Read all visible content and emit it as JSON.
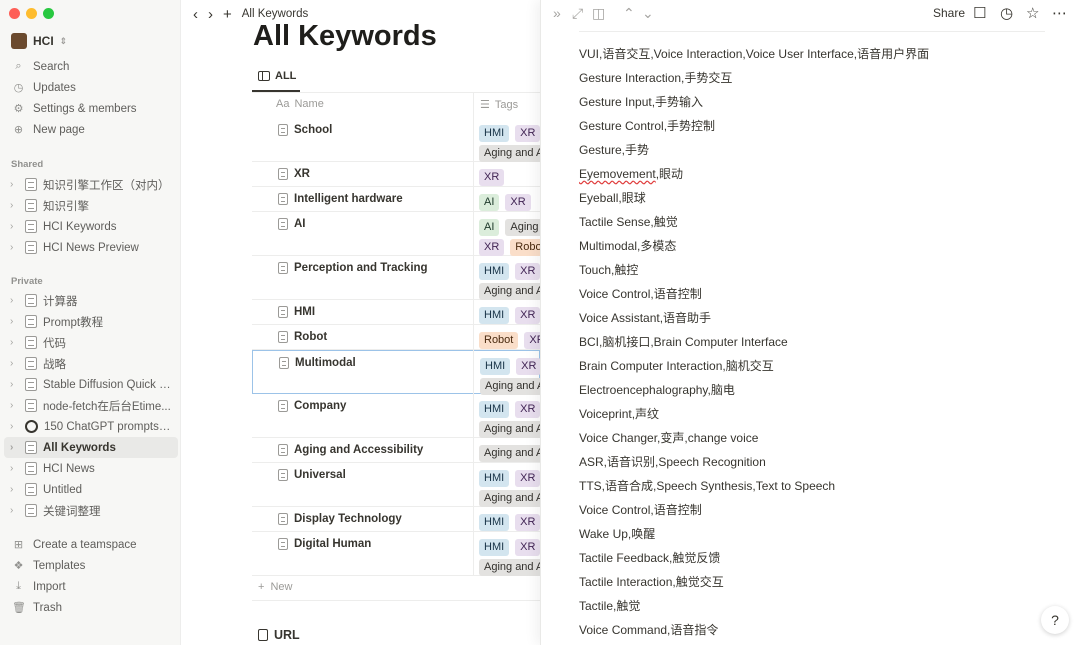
{
  "window": {
    "breadcrumb": "All Keywords"
  },
  "sidebar": {
    "workspace": "HCI",
    "nav": [
      {
        "label": "Search",
        "icon": "search-icon",
        "glyph": "⌕"
      },
      {
        "label": "Updates",
        "icon": "clock-icon",
        "glyph": "◷"
      },
      {
        "label": "Settings & members",
        "icon": "gear-icon",
        "glyph": "⚙"
      },
      {
        "label": "New page",
        "icon": "plus-circle-icon",
        "glyph": "⊕"
      }
    ],
    "shared_label": "Shared",
    "shared": [
      "知识引擎工作区（对内）",
      "知识引擎",
      "HCI Keywords",
      "HCI News Preview"
    ],
    "private_label": "Private",
    "private": [
      "计算器",
      "Prompt教程",
      "代码",
      "战略",
      "Stable Diffusion Quick S...",
      "node-fetch在后台Etime...",
      "150 ChatGPT prompts t...",
      "All Keywords",
      "HCI News",
      "Untitled",
      "关键词整理"
    ],
    "bottom": [
      {
        "label": "Create a teamspace",
        "icon": "teamspace-icon",
        "glyph": "⊞"
      },
      {
        "label": "Templates",
        "icon": "templates-icon",
        "glyph": "❖"
      },
      {
        "label": "Import",
        "icon": "import-icon",
        "glyph": "⤓"
      },
      {
        "label": "Trash",
        "icon": "trash-icon",
        "glyph": "🗑"
      }
    ]
  },
  "main": {
    "title": "All Keywords",
    "view_tab": "ALL",
    "columns": {
      "name": "Name",
      "name_prefix": "Aa",
      "tags": "Tags"
    },
    "rows": [
      {
        "name": "School",
        "tags": [
          [
            "HMI",
            "XR"
          ],
          [
            "Aging and A"
          ]
        ]
      },
      {
        "name": "XR",
        "tags": [
          [
            "XR"
          ]
        ]
      },
      {
        "name": "Intelligent hardware",
        "tags": [
          [
            "AI",
            "XR"
          ]
        ]
      },
      {
        "name": "AI",
        "tags": [
          [
            "AI",
            "Aging"
          ],
          [
            "XR",
            "Robot"
          ]
        ]
      },
      {
        "name": "Perception and Tracking",
        "tags": [
          [
            "HMI",
            "XR"
          ],
          [
            "Aging and A"
          ]
        ]
      },
      {
        "name": "HMI",
        "tags": [
          [
            "HMI",
            "XR"
          ]
        ]
      },
      {
        "name": "Robot",
        "tags": [
          [
            "Robot",
            "XR"
          ]
        ]
      },
      {
        "name": "Multimodal",
        "tags": [
          [
            "HMI",
            "XR"
          ],
          [
            "Aging and A"
          ]
        ]
      },
      {
        "name": "Company",
        "tags": [
          [
            "HMI",
            "XR"
          ],
          [
            "Aging and A"
          ]
        ]
      },
      {
        "name": "Aging and Accessibility",
        "tags": [
          [
            "Aging and A"
          ]
        ]
      },
      {
        "name": "Universal",
        "tags": [
          [
            "HMI",
            "XR"
          ],
          [
            "Aging and A"
          ]
        ]
      },
      {
        "name": "Display Technology",
        "tags": [
          [
            "HMI",
            "XR"
          ]
        ]
      },
      {
        "name": "Digital Human",
        "tags": [
          [
            "HMI",
            "XR"
          ],
          [
            "Aging and A"
          ]
        ]
      }
    ],
    "tag_colors": {
      "HMI": "blue",
      "XR": "purple",
      "Aging and A": "gray",
      "Aging": "gray",
      "AI": "green",
      "Robot": "orange"
    },
    "new_label": "New",
    "url_heading": "URL"
  },
  "peek": {
    "share_label": "Share",
    "keywords": [
      "VUI,语音交互,Voice Interaction,Voice User Interface,语音用户界面",
      "Gesture Interaction,手势交互",
      "Gesture Input,手势输入",
      "Gesture Control,手势控制",
      "Gesture,手势",
      "Eyemovement,眼动",
      "Eyeball,眼球",
      "Tactile Sense,触觉",
      "Multimodal,多模态",
      "Touch,触控",
      "Voice Control,语音控制",
      "Voice Assistant,语音助手",
      "BCI,脑机接口,Brain Computer Interface",
      "Brain Computer Interaction,脑机交互",
      "Electroencephalography,脑电",
      "Voiceprint,声纹",
      "Voice Changer,变声,change voice",
      "ASR,语音识别,Speech Recognition",
      "TTS,语音合成,Speech Synthesis,Text to Speech",
      "Voice Control,语音控制",
      "Wake Up,唤醒",
      "Tactile Feedback,触觉反馈",
      "Tactile Interaction,触觉交互",
      "Tactile,触觉",
      "Voice Command,语音指令"
    ],
    "help_label": "?"
  }
}
